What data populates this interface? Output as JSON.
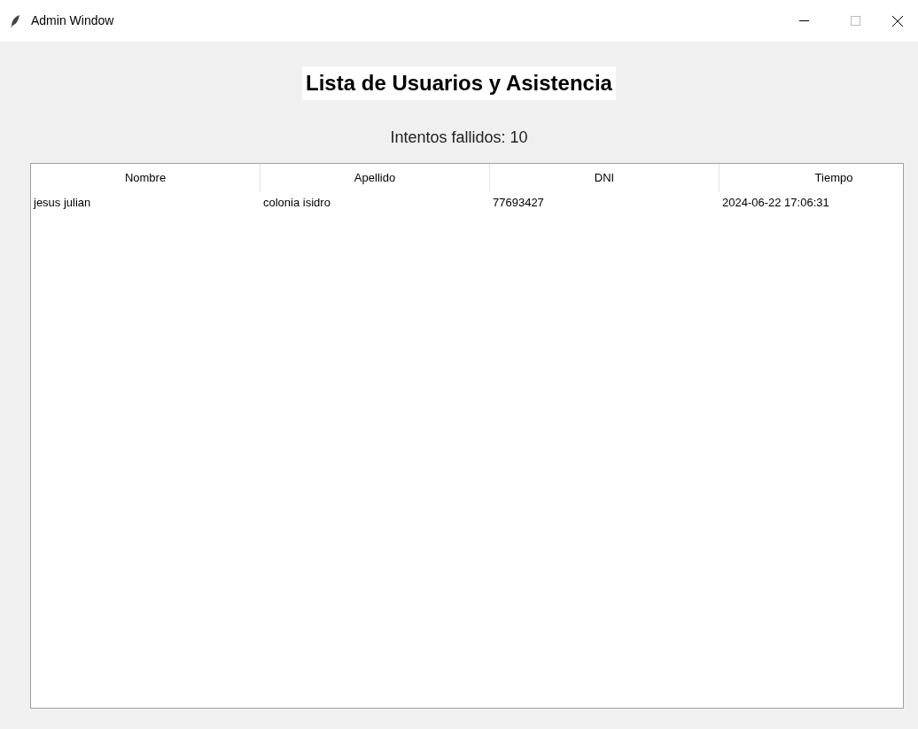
{
  "window": {
    "title": "Admin Window"
  },
  "heading": "Lista de Usuarios y Asistencia",
  "failed_attempts": "Intentos fallidos: 10",
  "table": {
    "columns": [
      "Nombre",
      "Apellido",
      "DNI",
      "Tiempo"
    ],
    "rows": [
      [
        "jesus julian",
        "colonia isidro",
        "77693427",
        "2024-06-22 17:06:31"
      ]
    ]
  }
}
